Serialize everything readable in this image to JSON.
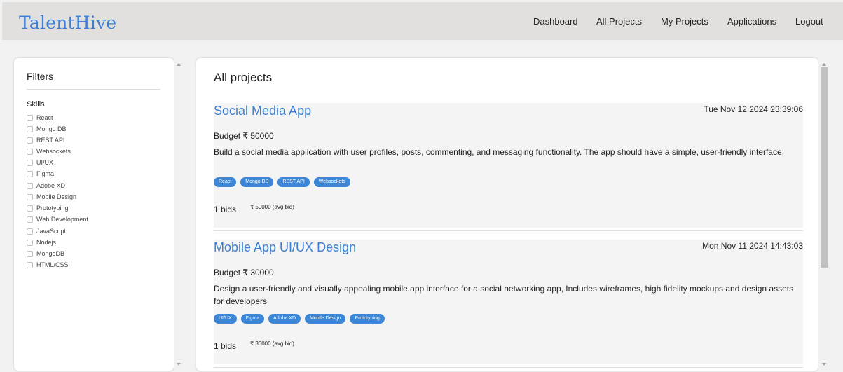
{
  "navbar": {
    "brand": "TalentHive",
    "links": [
      "Dashboard",
      "All Projects",
      "My Projects",
      "Applications",
      "Logout"
    ]
  },
  "sidebar": {
    "title": "Filters",
    "skills_label": "Skills",
    "skills": [
      "React",
      "Mongo DB",
      "REST API",
      "Websockets",
      "UI/UX",
      "Figma",
      "Adobe XD",
      "Mobile Design",
      "Prototyping",
      "Web Development",
      "JavaScript",
      "Nodejs",
      "MongoDB",
      "HTML/CSS"
    ]
  },
  "main": {
    "title": "All projects",
    "projects": [
      {
        "title": "Social Media App",
        "date": "Tue Nov 12 2024 23:39:06",
        "budget": "Budget ₹ 50000",
        "description": "Build a social media application with user profiles, posts, commenting, and messaging functionality. The app should have a simple, user-friendly interface.",
        "tags": [
          "React",
          "Mongo DB",
          "REST API",
          "Websockets"
        ],
        "bids": "1 bids",
        "avg_bid": "₹ 50000 (avg bid)"
      },
      {
        "title": "Mobile App UI/UX Design",
        "date": "Mon Nov 11 2024 14:43:03",
        "budget": "Budget ₹ 30000",
        "description": "Design a user-friendly and visually appealing mobile app interface for a social networking app, Includes wireframes, high fidelity mockups and design assets for developers",
        "tags": [
          "UI/UX",
          "Figma",
          "Adobe XD",
          "Mobile Design",
          "Prototyping"
        ],
        "bids": "1 bids",
        "avg_bid": "₹ 30000 (avg bid)"
      }
    ]
  },
  "colors": {
    "brand": "#3b7fd4",
    "tag_bg": "#3b86d6",
    "navbar_bg": "#e2e0df",
    "page_bg": "#f2f2f2"
  }
}
